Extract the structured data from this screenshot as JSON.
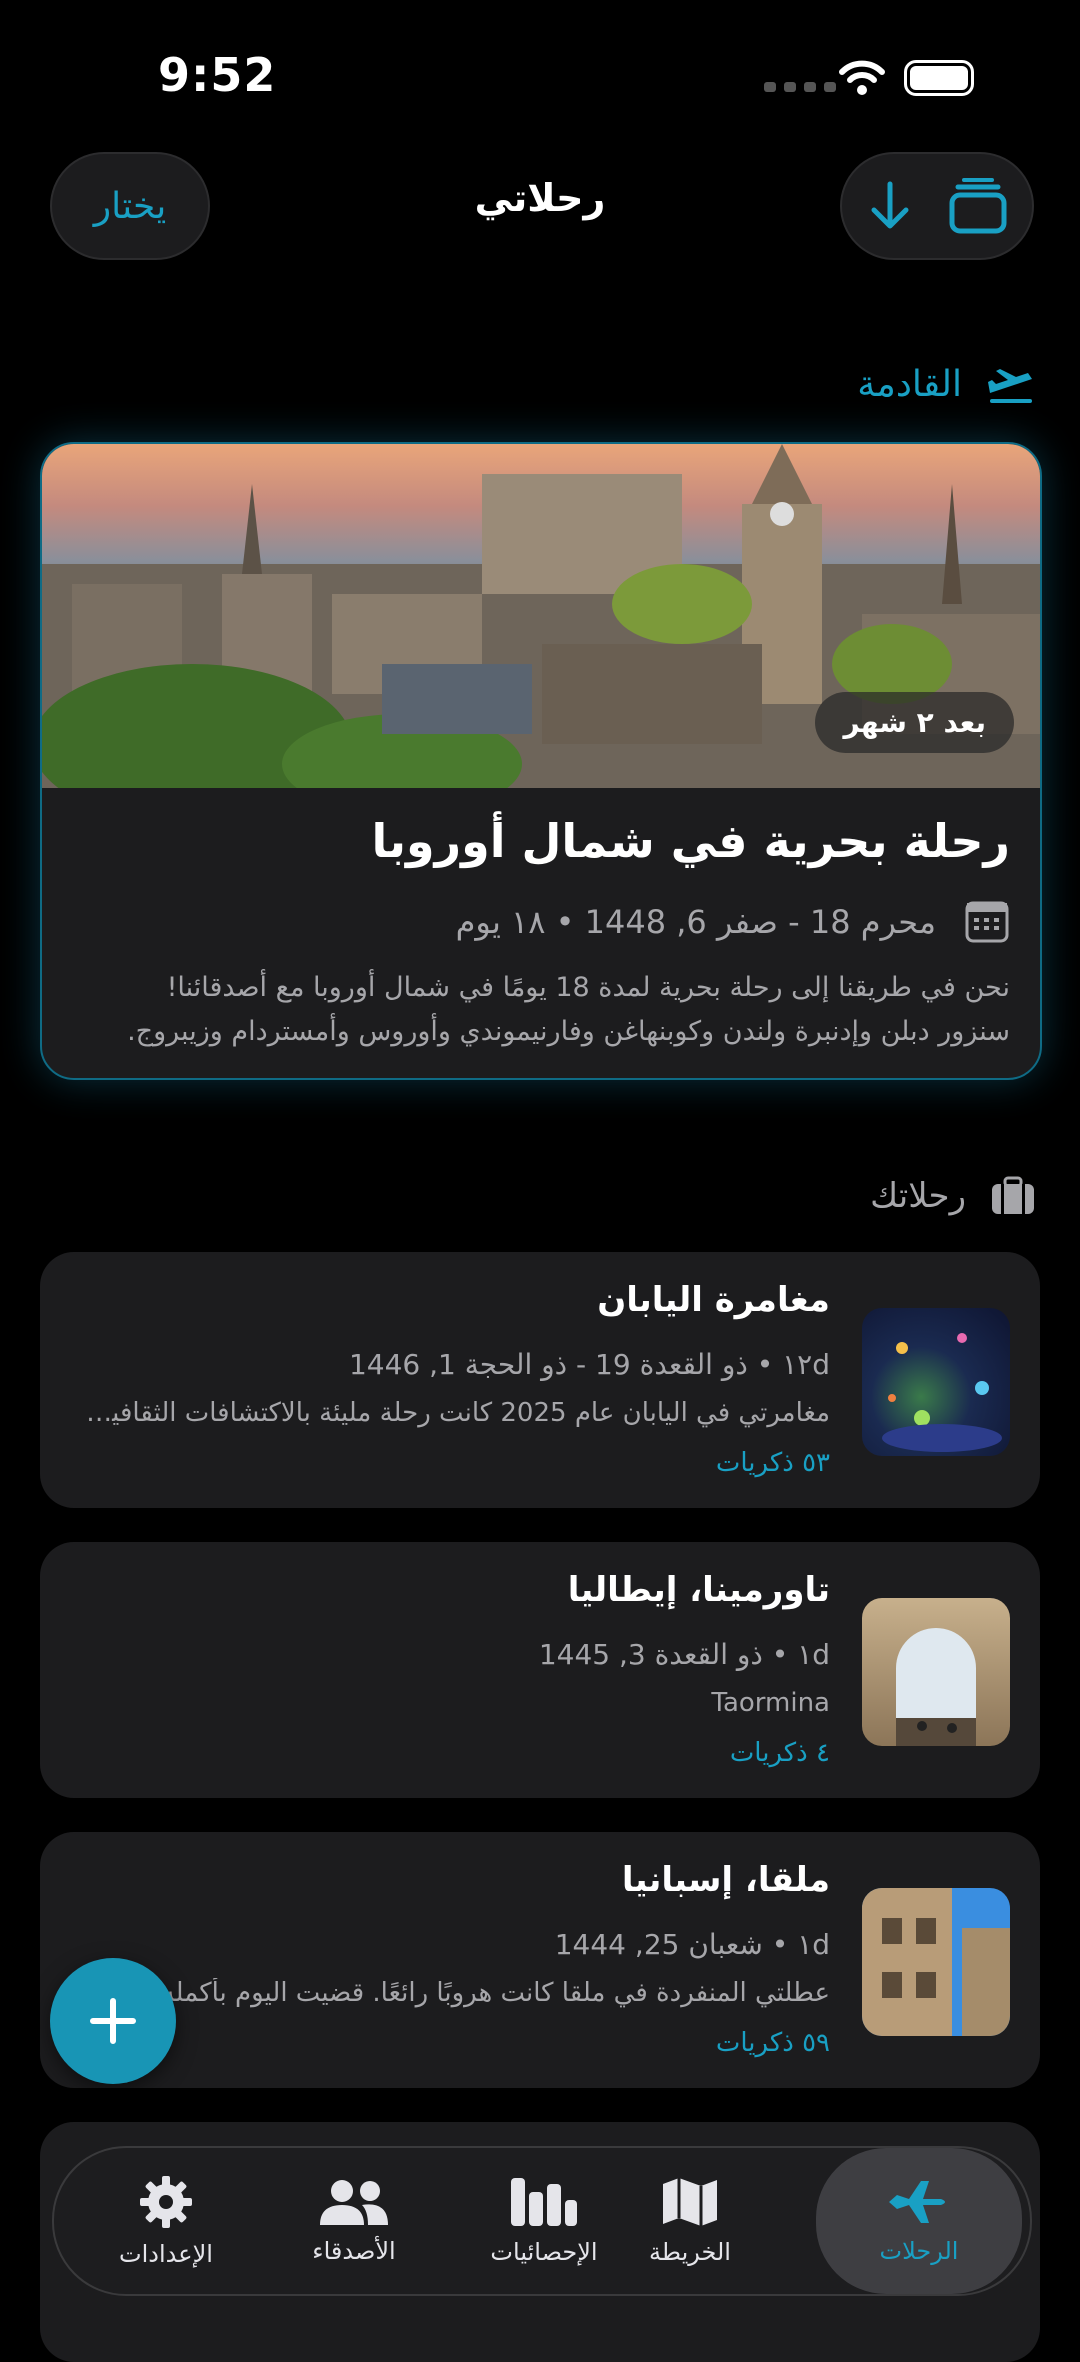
{
  "status": {
    "time": "9:52"
  },
  "header": {
    "title": "رحلاتي",
    "select_label": "يختار"
  },
  "upcoming": {
    "section_label": "القادمة",
    "badge": "بعد ٢ شهر",
    "title": "رحلة بحرية في شمال أوروبا",
    "dates": "محرم 18 - صفر 6, 1448 • ١٨ يوم",
    "description": "نحن في طريقنا إلى رحلة بحرية لمدة 18 يومًا في شمال أوروبا مع أصدقائنا! سنزور دبلن وإدنبرة ولندن وكوبنهاغن وفارنيموندي وأوروس وأمستردام وزيبروج."
  },
  "trips_section_label": "رحلاتك",
  "trips": [
    {
      "title": "مغامرة اليابان",
      "meta": "١٢d • ذو القعدة 19 - ذو الحجة 1, 1446",
      "desc": "مغامرتي في اليابان عام 2025 كانت رحلة مليئة بالاكتشافات الثقافية. م...",
      "memories": "٥٣ ذكريات"
    },
    {
      "title": "تاورمينا، إيطاليا",
      "meta": "١d • ذو القعدة 3, 1445",
      "desc": "Taormina",
      "memories": "٤ ذكريات"
    },
    {
      "title": "ملقا، إسبانيا",
      "meta": "١d • شعبان 25, 1444",
      "desc": "عطلتي المنفردة في ملقا كانت هروبًا رائعًا. قضيت اليوم بأكمله أ...",
      "memories": "٥٩ ذكريات"
    }
  ],
  "tabs": {
    "trips": "الرحلات",
    "map": "الخريطة",
    "stats": "الإحصائيات",
    "friends": "الأصدقاء",
    "settings": "الإعدادات"
  },
  "colors": {
    "accent": "#19a0c4",
    "background": "#000000",
    "card": "#1c1c1e"
  }
}
